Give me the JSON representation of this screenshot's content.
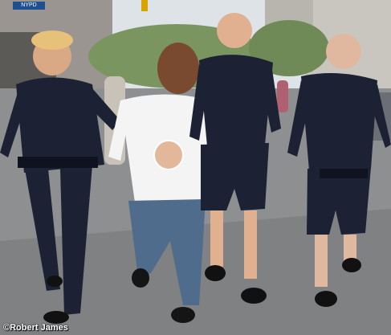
{
  "image": {
    "street_sign_text": "NYPD",
    "credit": "©Robert James"
  },
  "colors": {
    "uniform": "#1c2233",
    "shirt": "#f4f4f4",
    "jeans": "#4f6c8c",
    "skin": "#d9a884",
    "asphalt": "#8d8f91",
    "sky": "#dde3e6",
    "trees": "#7a9560"
  }
}
